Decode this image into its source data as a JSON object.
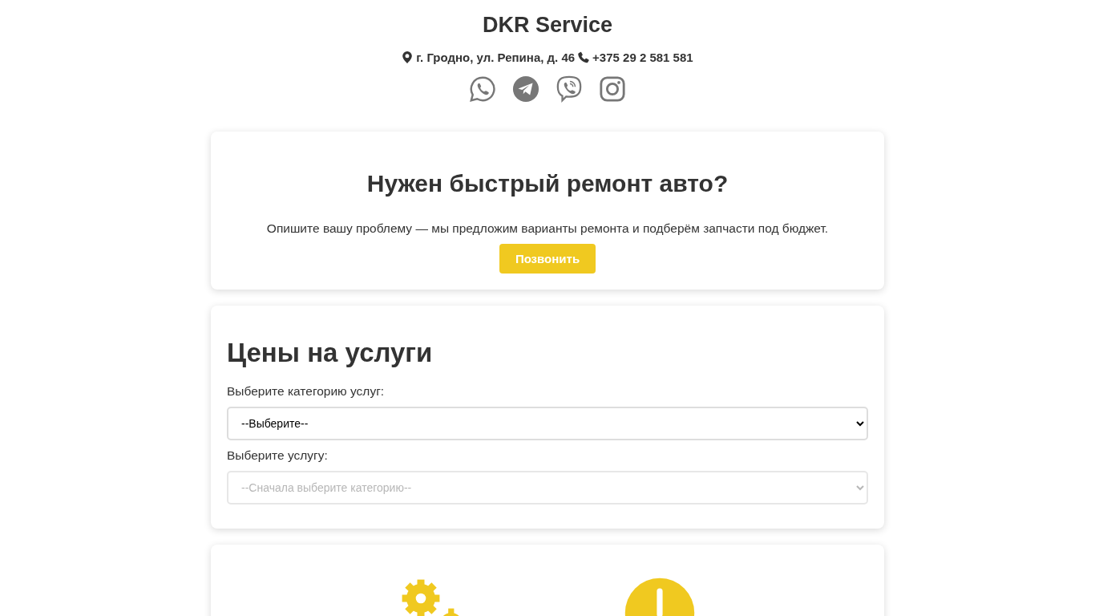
{
  "header": {
    "title": "DKR Service",
    "address": "г. Гродно, ул. Репина, д. 46",
    "phone": "+375 29 2 581 581",
    "socials": [
      {
        "kind": "whatsapp"
      },
      {
        "kind": "telegram"
      },
      {
        "kind": "viber"
      },
      {
        "kind": "instagram"
      }
    ]
  },
  "hero": {
    "title": "Нужен быстрый ремонт авто?",
    "text": "Опишите вашу проблему — мы предложим варианты ремонта и подберём запчасти под бюджет.",
    "button": "Позвонить"
  },
  "prices": {
    "title": "Цены на услуги",
    "fields": [
      {
        "label": "Выберите категорию услуг:",
        "value": "--Выберите--",
        "disabled": false
      },
      {
        "label": "Выберите услугу:",
        "value": "--Сначала выберите категорию--",
        "disabled": true
      }
    ]
  },
  "features": [
    {
      "kind": "gears"
    },
    {
      "kind": "clock"
    }
  ]
}
